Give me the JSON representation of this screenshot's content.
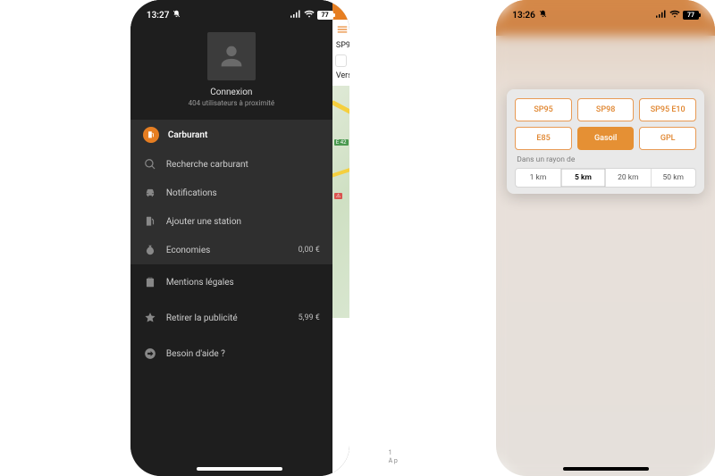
{
  "screen1": {
    "status": {
      "time": "13:27",
      "battery": "77"
    },
    "profile": {
      "title": "Connexion",
      "subtitle": "404 utilisateurs à proximité"
    },
    "section_fuel": {
      "header": "Carburant",
      "items": [
        {
          "label": "Recherche carburant"
        },
        {
          "label": "Notifications"
        },
        {
          "label": "Ajouter une station"
        },
        {
          "label": "Economies",
          "value": "0,00 €"
        }
      ]
    },
    "section_misc": {
      "legal": "Mentions légales",
      "remove_ads": {
        "label": "Retirer la publicité",
        "price": "5,99 €"
      },
      "help": "Besoin d'aide ?"
    },
    "peek": {
      "title_fragment": "SP9",
      "row2": "Vers",
      "road_tag": "E 42"
    }
  },
  "middle_text": {
    "line1": "1",
    "line2": "A p"
  },
  "screen2": {
    "status": {
      "time": "13:26",
      "battery": "77"
    },
    "modal": {
      "fuels_row1": [
        "SP95",
        "SP98",
        "SP95 E10"
      ],
      "fuels_row2": [
        "E85",
        "Gasoil",
        "GPL"
      ],
      "selected_fuel": "Gasoil",
      "radius_label": "Dans un rayon de",
      "radius_options": [
        "1 km",
        "5 km",
        "20 km",
        "50 km"
      ],
      "selected_radius": "5 km"
    }
  },
  "colors": {
    "accent": "#e67e22"
  }
}
